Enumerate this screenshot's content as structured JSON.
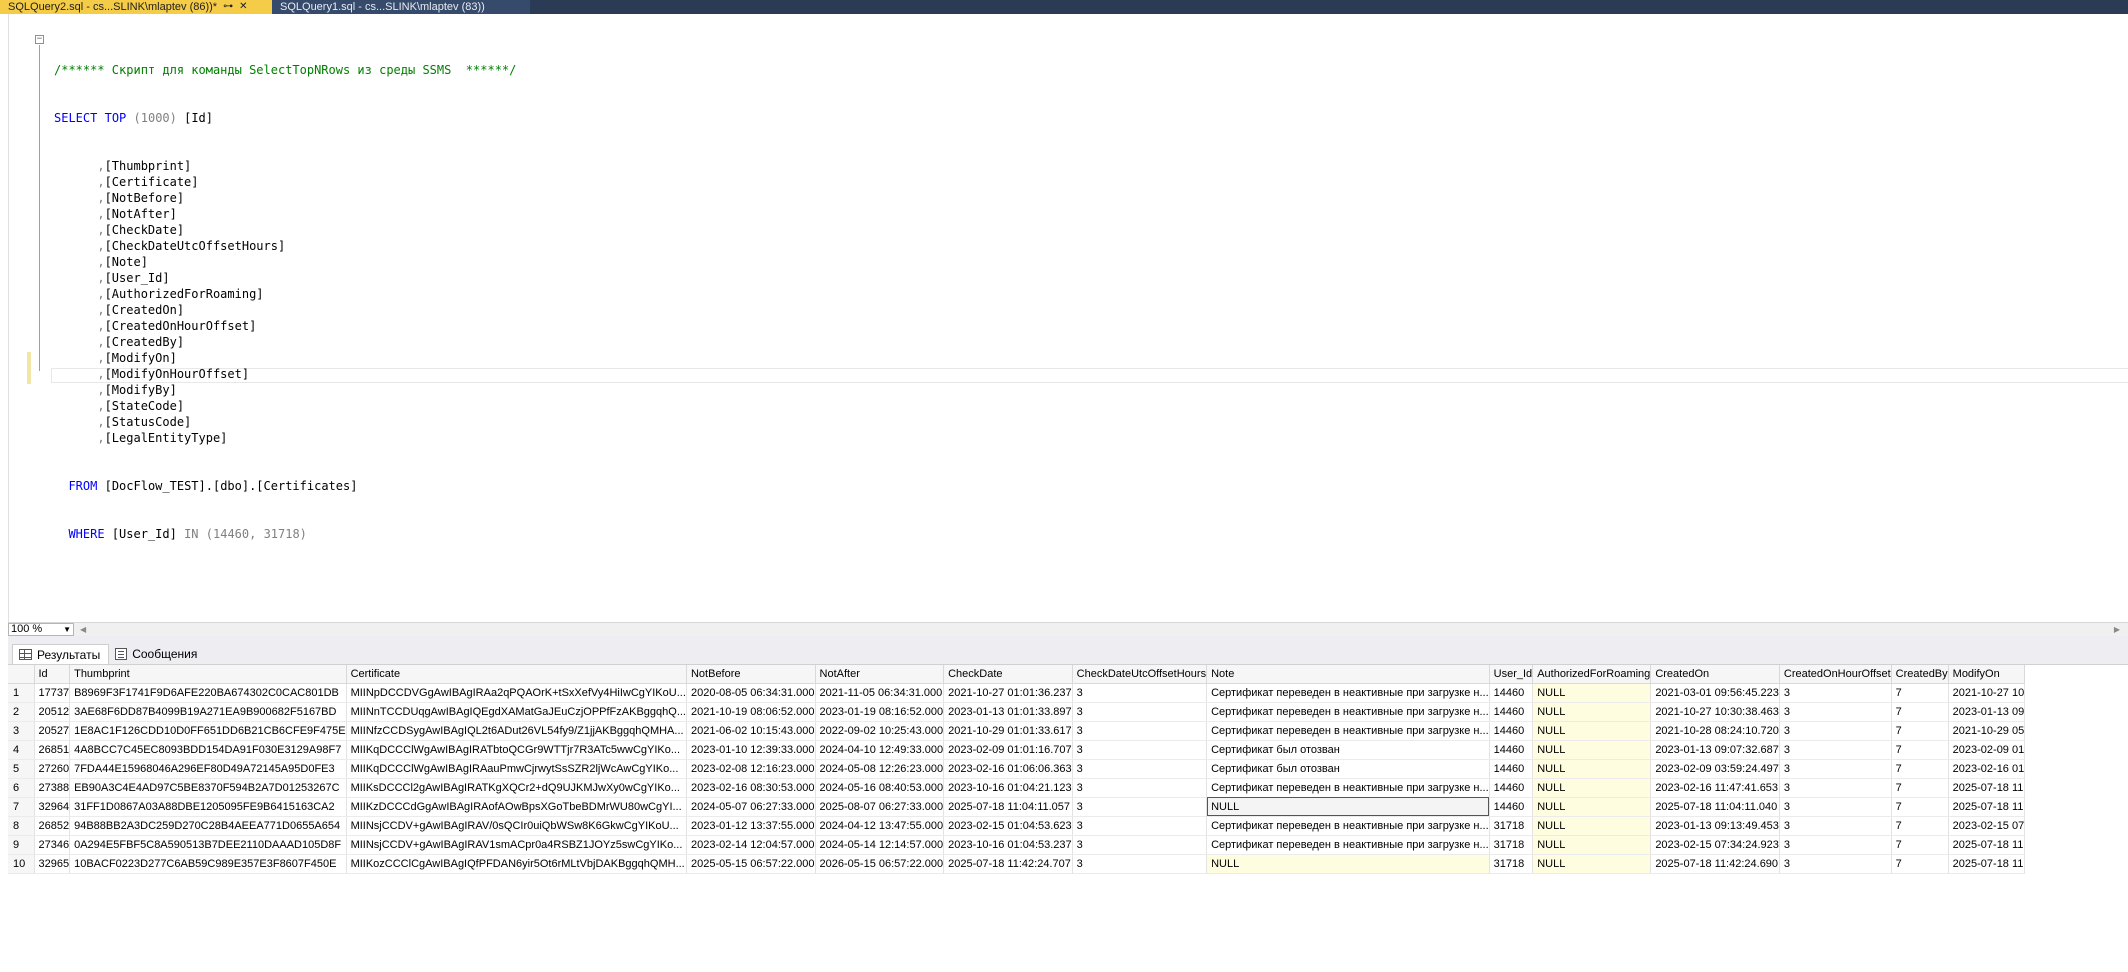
{
  "tabs": [
    {
      "label": "SQLQuery2.sql - cs...SLINK\\mlaptev (86))*",
      "active": true
    },
    {
      "label": "SQLQuery1.sql - cs...SLINK\\mlaptev (83))",
      "active": false
    }
  ],
  "editor": {
    "comment": "/****** Скрипт для команды SelectTopNRows из среды SSMS  ******/",
    "select_kw": "SELECT",
    "top_kw": "TOP",
    "top_value": "(1000)",
    "first_col": "[Id]",
    "columns": [
      "[Thumbprint]",
      "[Certificate]",
      "[NotBefore]",
      "[NotAfter]",
      "[CheckDate]",
      "[CheckDateUtcOffsetHours]",
      "[Note]",
      "[User_Id]",
      "[AuthorizedForRoaming]",
      "[CreatedOn]",
      "[CreatedOnHourOffset]",
      "[CreatedBy]",
      "[ModifyOn]",
      "[ModifyOnHourOffset]",
      "[ModifyBy]",
      "[StateCode]",
      "[StatusCode]",
      "[LegalEntityType]"
    ],
    "from_kw": "FROM",
    "from_table": "[DocFlow_TEST].[dbo].[Certificates]",
    "where_kw": "WHERE",
    "where_col": "[User_Id]",
    "in_kw": "IN",
    "in_values": "(14460, 31718)"
  },
  "zoom": "100 %",
  "result_tabs": {
    "results": "Результаты",
    "messages": "Сообщения"
  },
  "grid": {
    "columns": [
      "Id",
      "Thumbprint",
      "Certificate",
      "NotBefore",
      "NotAfter",
      "CheckDate",
      "CheckDateUtcOffsetHours",
      "Note",
      "User_Id",
      "AuthorizedForRoaming",
      "CreatedOn",
      "CreatedOnHourOffset",
      "CreatedBy",
      "ModifyOn"
    ],
    "rows": [
      [
        "1",
        "17737",
        "B8969F3F1741F9D6AFE220BA674302C0CAC801DB",
        "MIINpDCCDVGgAwIBAgIRAa2qPQAOrK+tSxXefVy4HiIwCgYIKoU...",
        "2020-08-05 06:34:31.000",
        "2021-11-05 06:34:31.000",
        "2021-10-27 01:01:36.237",
        "3",
        "Сертификат переведен в неактивные при загрузке н...",
        "14460",
        "NULL",
        "2021-03-01 09:56:45.223",
        "3",
        "7",
        "2021-10-27 10"
      ],
      [
        "2",
        "20512",
        "3AE68F6DD87B4099B19A271EA9B900682F5167BD",
        "MIINnTCCDUqgAwIBAgIQEgdXAMatGaJEuCzjOPPfFzAKBggqhQ...",
        "2021-10-19 08:06:52.000",
        "2023-01-19 08:16:52.000",
        "2023-01-13 01:01:33.897",
        "3",
        "Сертификат переведен в неактивные при загрузке н...",
        "14460",
        "NULL",
        "2021-10-27 10:30:38.463",
        "3",
        "7",
        "2023-01-13 09"
      ],
      [
        "3",
        "20527",
        "1E8AC1F126CDD10D0FF651DD6B21CB6CFE9F475E",
        "MIINfzCCDSygAwIBAgIQL2t6ADut26VL54fy9/Z1jjAKBggqhQMHA...",
        "2021-06-02 10:15:43.000",
        "2022-09-02 10:25:43.000",
        "2021-10-29 01:01:33.617",
        "3",
        "Сертификат переведен в неактивные при загрузке н...",
        "14460",
        "NULL",
        "2021-10-28 08:24:10.720",
        "3",
        "7",
        "2021-10-29 05"
      ],
      [
        "4",
        "26851",
        "4A8BCC7C45EC8093BDD154DA91F030E3129A98F7",
        "MIIKqDCCClWgAwIBAgIRATbtoQCGr9WTTjr7R3ATc5wwCgYIKo...",
        "2023-01-10 12:39:33.000",
        "2024-04-10 12:49:33.000",
        "2023-02-09 01:01:16.707",
        "3",
        "Сертификат был отозван",
        "14460",
        "NULL",
        "2023-01-13 09:07:32.687",
        "3",
        "7",
        "2023-02-09 01"
      ],
      [
        "5",
        "27260",
        "7FDA44E15968046A296EF80D49A72145A95D0FE3",
        "MIIKqDCCClWgAwIBAgIRAauPmwCjrwytSsSZR2ljWcAwCgYIKo...",
        "2023-02-08 12:16:23.000",
        "2024-05-08 12:26:23.000",
        "2023-02-16 01:06:06.363",
        "3",
        "Сертификат был отозван",
        "14460",
        "NULL",
        "2023-02-09 03:59:24.497",
        "3",
        "7",
        "2023-02-16 01"
      ],
      [
        "6",
        "27388",
        "EB90A3C4E4AD97C5BE8370F594B2A7D01253267C",
        "MIIKsDCCCl2gAwIBAgIRATKgXQCr2+dQ9UJKMJwXy0wCgYIKo...",
        "2023-02-16 08:30:53.000",
        "2024-05-16 08:40:53.000",
        "2023-10-16 01:04:21.123",
        "3",
        "Сертификат переведен в неактивные при загрузке н...",
        "14460",
        "NULL",
        "2023-02-16 11:47:41.653",
        "3",
        "7",
        "2025-07-18 11"
      ],
      [
        "7",
        "32964",
        "31FF1D0867A03A88DBE1205095FE9B6415163CA2",
        "MIIKzDCCCdGgAwIBAgIRAofAOwBpsXGoTbeBDMrWU80wCgYI...",
        "2024-05-07 06:27:33.000",
        "2025-08-07 06:27:33.000",
        "2025-07-18 11:04:11.057",
        "3",
        "NULL",
        "14460",
        "NULL",
        "2025-07-18 11:04:11.040",
        "3",
        "7",
        "2025-07-18 11"
      ],
      [
        "8",
        "26852",
        "94B88BB2A3DC259D270C28B4AEEA771D0655A654",
        "MIINsjCCDV+gAwIBAgIRAV/0sQCIr0uiQbWSw8K6GkwCgYIKoU...",
        "2023-01-12 13:37:55.000",
        "2024-04-12 13:47:55.000",
        "2023-02-15 01:04:53.623",
        "3",
        "Сертификат переведен в неактивные при загрузке н...",
        "31718",
        "NULL",
        "2023-01-13 09:13:49.453",
        "3",
        "7",
        "2023-02-15 07"
      ],
      [
        "9",
        "27346",
        "0A294E5FBF5C8A590513B7DEE2110DAAAD105D8F",
        "MIINsjCCDV+gAwIBAgIRAV1smACpr0a4RSBZ1JOYz5swCgYIKo...",
        "2023-02-14 12:04:57.000",
        "2024-05-14 12:14:57.000",
        "2023-10-16 01:04:53.237",
        "3",
        "Сертификат переведен в неактивные при загрузке н...",
        "31718",
        "NULL",
        "2023-02-15 07:34:24.923",
        "3",
        "7",
        "2025-07-18 11"
      ],
      [
        "10",
        "32965",
        "10BACF0223D277C6AB59C989E357E3F8607F450E",
        "MIIKozCCClCgAwIBAgIQfPFDAN6yir5Ot6rMLtVbjDAKBggqhQMH...",
        "2025-05-15 06:57:22.000",
        "2026-05-15 06:57:22.000",
        "2025-07-18 11:42:24.707",
        "3",
        "NULL",
        "31718",
        "NULL",
        "2025-07-18 11:42:24.690",
        "3",
        "7",
        "2025-07-18 11"
      ]
    ]
  }
}
